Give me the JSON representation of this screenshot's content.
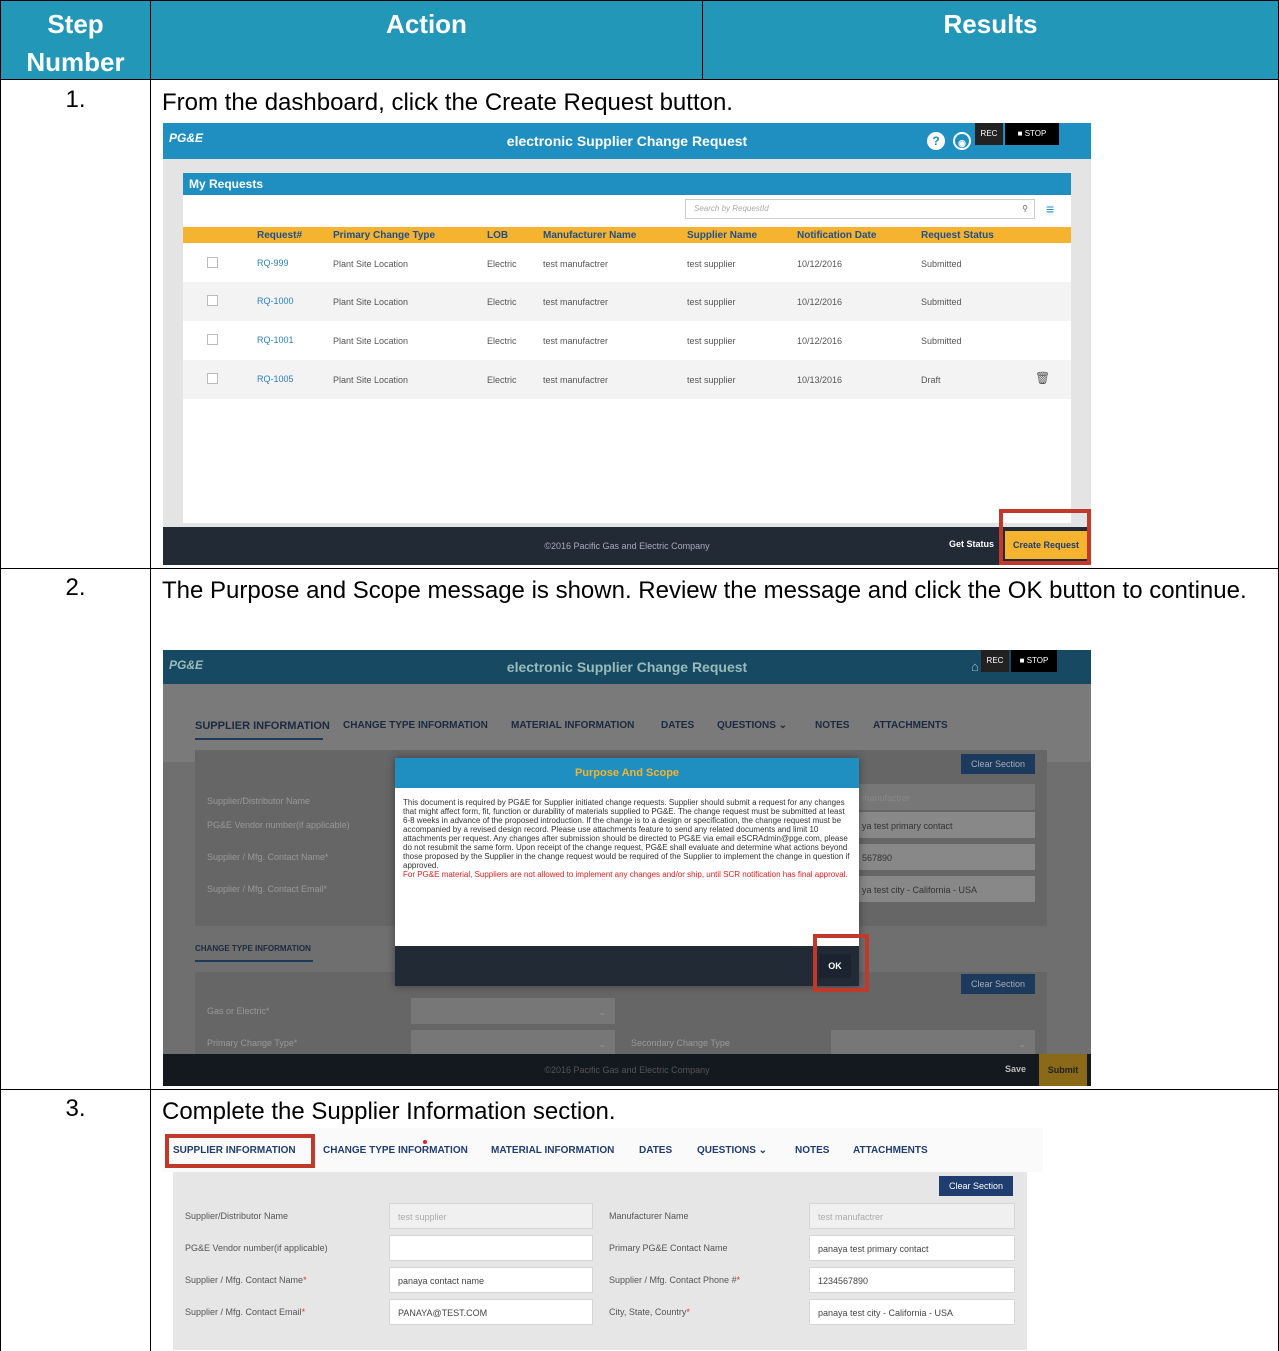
{
  "headers": {
    "step": "Step Number",
    "action": "Action",
    "results": "Results"
  },
  "steps": [
    {
      "number": "1.",
      "text": "From the dashboard, click the Create Request button."
    },
    {
      "number": "2.",
      "text": "The Purpose and Scope message is shown. Review the message and click the OK button to continue."
    },
    {
      "number": "3.",
      "text": "Complete the Supplier Information section."
    }
  ],
  "app": {
    "logo": "PG&E",
    "title": "electronic Supplier Change Request",
    "rec": "REC",
    "stop": "■ STOP",
    "help_icon": "?",
    "footer": "©2016 Pacific Gas and Electric Company"
  },
  "shot1": {
    "panel_title": "My Requests",
    "search_placeholder": "Search by RequestId",
    "columns": [
      "Request#",
      "Primary Change Type",
      "LOB",
      "Manufacturer Name",
      "Supplier Name",
      "Notification Date",
      "Request Status"
    ],
    "rows": [
      [
        "RQ-999",
        "Plant Site Location",
        "Electric",
        "test manufactrer",
        "test supplier",
        "10/12/2016",
        "Submitted"
      ],
      [
        "RQ-1000",
        "Plant Site Location",
        "Electric",
        "test manufactrer",
        "test supplier",
        "10/12/2016",
        "Submitted"
      ],
      [
        "RQ-1001",
        "Plant Site Location",
        "Electric",
        "test manufactrer",
        "test supplier",
        "10/12/2016",
        "Submitted"
      ],
      [
        "RQ-1005",
        "Plant Site Location",
        "Electric",
        "test manufactrer",
        "test supplier",
        "10/13/2016",
        "Draft"
      ]
    ],
    "get_status": "Get Status",
    "create_request": "Create Request"
  },
  "tabs": [
    "SUPPLIER INFORMATION",
    "CHANGE TYPE INFORMATION",
    "MATERIAL INFORMATION",
    "DATES",
    "QUESTIONS ⌄",
    "NOTES",
    "ATTACHMENTS"
  ],
  "shot2": {
    "clear_section": "Clear Section",
    "bg_labels": [
      "Supplier/Distributor Name",
      "PG&E Vendor number(if applicable)",
      "Supplier / Mfg. Contact Name*",
      "Supplier / Mfg. Contact Email*"
    ],
    "bg_values": [
      "manufactrer",
      "ya test primary contact",
      "567890",
      "ya test city - California - USA"
    ],
    "change_section": "CHANGE TYPE INFORMATION",
    "gas_label": "Gas or Electric*",
    "primary_label": "Primary Change Type*",
    "secondary_label": "Secondary Change Type",
    "modal_title": "Purpose And Scope",
    "modal_body": "This document is required by PG&E for Supplier initiated change requests. Supplier should submit a request for any changes that might affect form, fit, function or durability of materials supplied to PG&E. The change request must be submitted at least 6-8 weeks in advance of the proposed introduction. If the change is to a design or specification, the change request must be accompanied by a revised design record. Please use attachments feature to send any related documents and limit 10 attachments per request. Any changes after submission should be directed to PG&E via email eSCRAdmin@pge.com, please do not resubmit the same form. Upon receipt of the change request, PG&E shall evaluate and determine what actions beyond those proposed by the Supplier in the change request would be required of the Supplier to implement the change in question if approved.",
    "modal_warning": "For PG&E material, Suppliers are not allowed to implement any changes and/or ship, until SCR notification has final approval.",
    "ok": "OK",
    "save": "Save",
    "submit": "Submit"
  },
  "shot3": {
    "clear_section": "Clear Section",
    "left_labels": [
      "Supplier/Distributor Name",
      "PG&E Vendor number(if applicable)",
      "Supplier / Mfg. Contact Name",
      "Supplier / Mfg. Contact Email"
    ],
    "left_values": [
      "test supplier",
      "",
      "panaya contact name",
      "PANAYA@TEST.COM"
    ],
    "right_labels": [
      "Manufacturer Name",
      "Primary PG&E Contact Name",
      "Supplier / Mfg. Contact Phone #",
      "City, State, Country"
    ],
    "right_values": [
      "test manufactrer",
      "panaya test primary contact",
      "1234567890",
      "panaya test city - California - USA"
    ],
    "required_mark": "*"
  },
  "colors": {
    "header_bg": "#2397b8",
    "app_blue": "#1f8fc1",
    "table_header": "#f5b330",
    "highlight": "#c0392b",
    "footer": "#222a36"
  }
}
